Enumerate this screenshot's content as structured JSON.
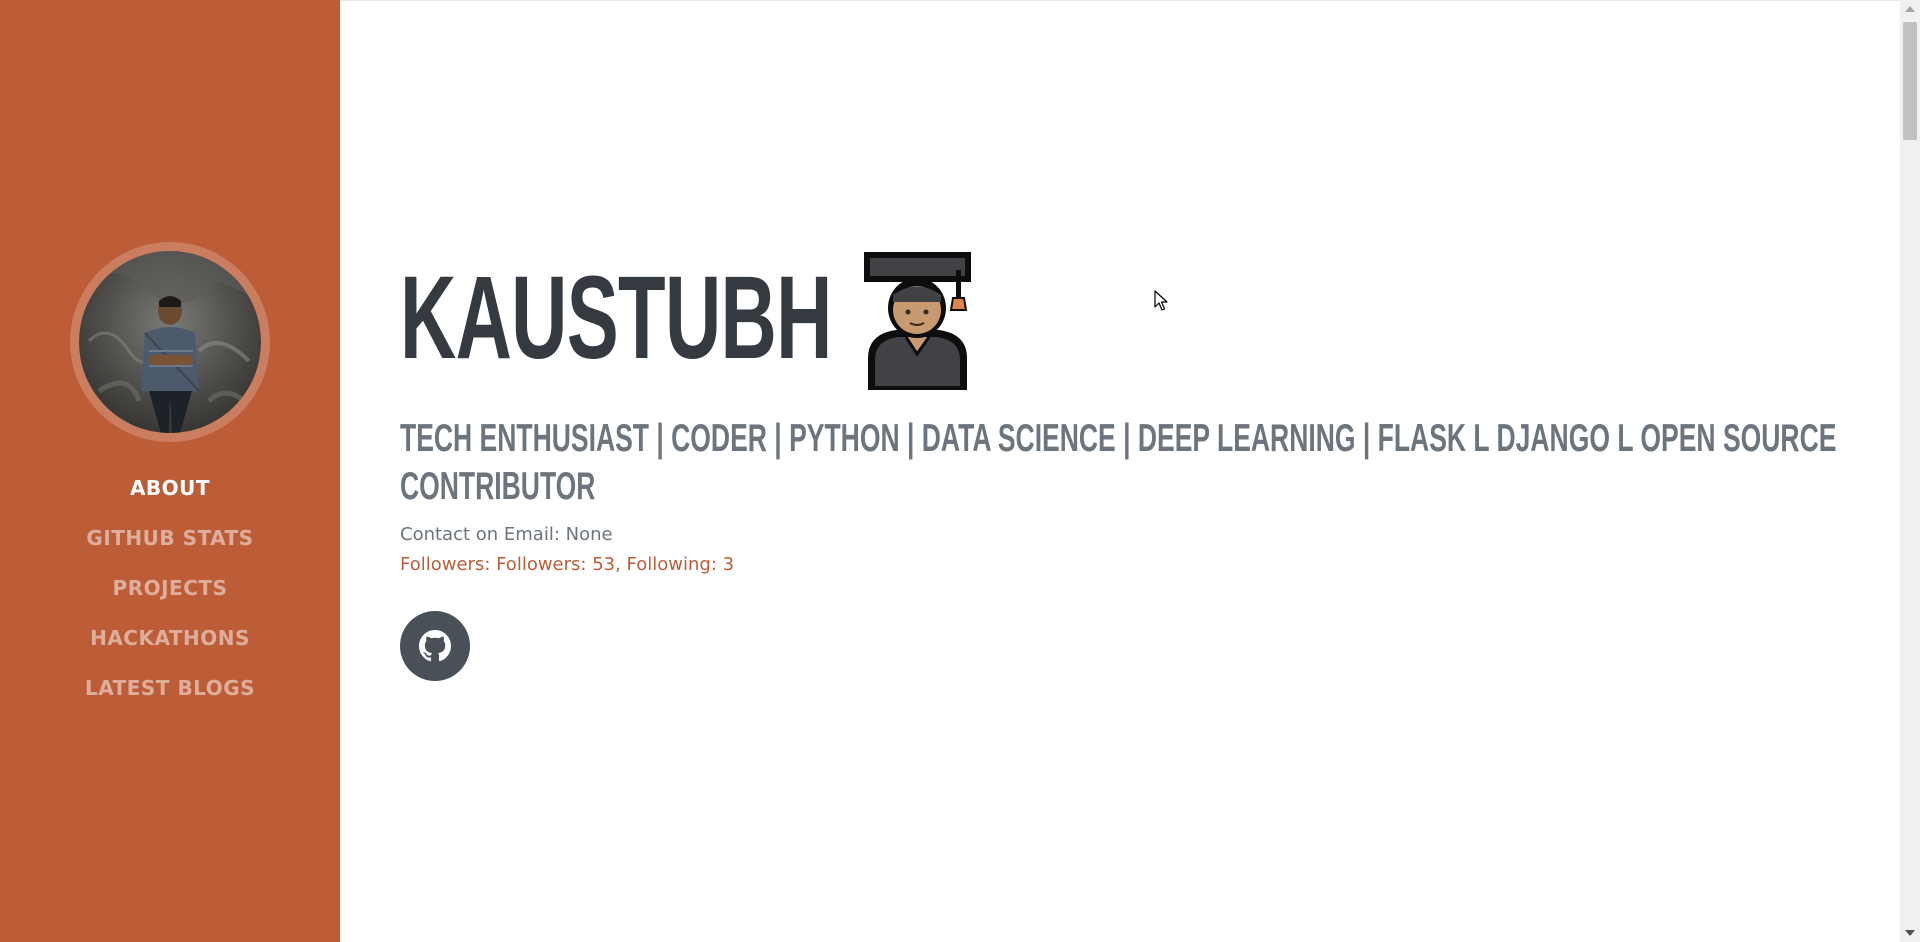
{
  "sidebar": {
    "avatar_alt": "profile photo",
    "nav": [
      {
        "label": "ABOUT",
        "active": true
      },
      {
        "label": "GITHUB STATS",
        "active": false
      },
      {
        "label": "PROJECTS",
        "active": false
      },
      {
        "label": "HACKATHONS",
        "active": false
      },
      {
        "label": "LATEST BLOGS",
        "active": false
      }
    ]
  },
  "profile": {
    "name": "KAUSTUBH",
    "name_emoji": "graduate-emoji",
    "tagline_line1": "TECH ENTHUSIAST | CODER | PYTHON | DATA SCIENCE | DEEP LEARNING | FLASK L DJANGO L OPEN SOURCE",
    "tagline_line2": "CONTRIBUTOR",
    "contact": "Contact on Email: None",
    "followers": "Followers: Followers: 53, Following: 3",
    "social_icon": "github-icon"
  },
  "colors": {
    "sidebar_bg": "#bd5d38",
    "accent": "#bd5d38",
    "heading": "#343a40",
    "muted": "#6c757d",
    "social_btn": "#495057"
  }
}
